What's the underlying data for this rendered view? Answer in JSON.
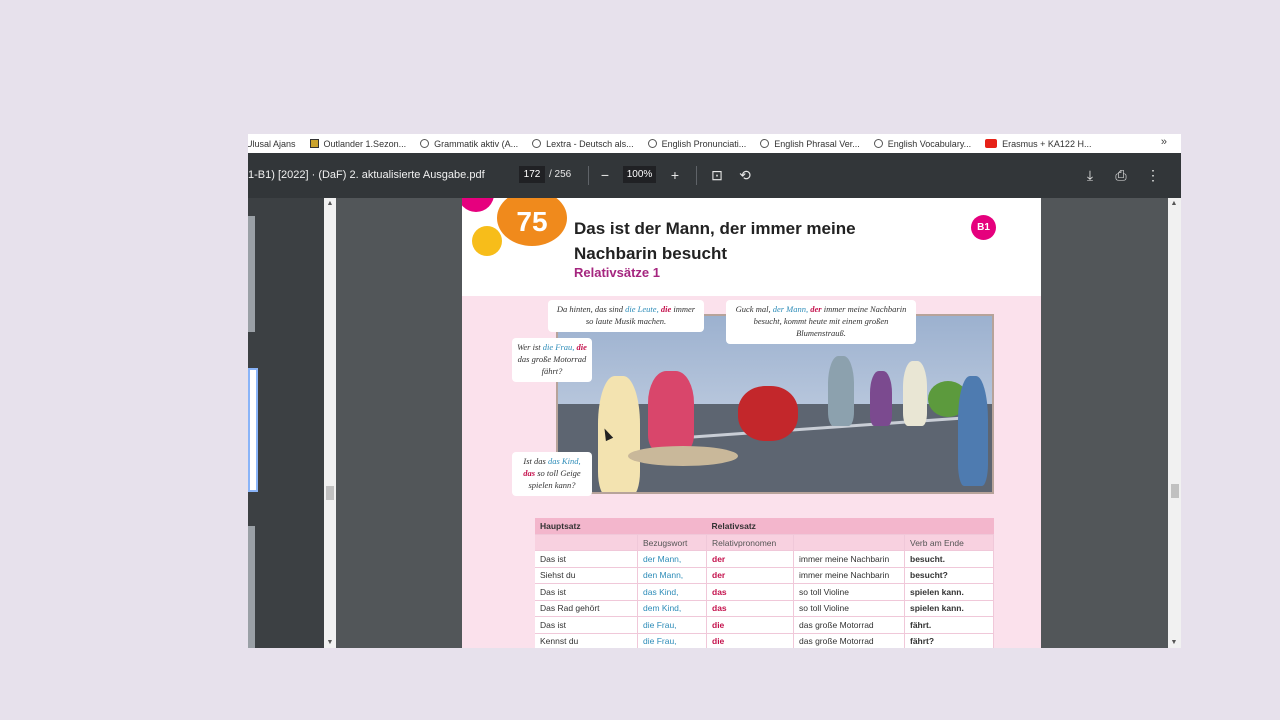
{
  "bookmarks": [
    {
      "label": "Ulusal Ajans",
      "icon": "none"
    },
    {
      "label": "Outlander 1.Sezon...",
      "icon": "folder-icon"
    },
    {
      "label": "Grammatik aktiv (A...",
      "icon": "globe-icon"
    },
    {
      "label": "Lextra - Deutsch als...",
      "icon": "globe-icon"
    },
    {
      "label": "English Pronunciati...",
      "icon": "globe-icon"
    },
    {
      "label": "English Phrasal Ver...",
      "icon": "globe-icon"
    },
    {
      "label": "English Vocabulary...",
      "icon": "globe-icon"
    },
    {
      "label": "Erasmus + KA122 H...",
      "icon": "youtube-icon"
    }
  ],
  "bookmarks_more": "»",
  "viewer": {
    "doc_title": "1-B1) [2022] · (DaF) 2. aktualisierte Ausgabe.pdf",
    "page_current": "172",
    "page_total": "/ 256",
    "zoom": "100%",
    "icons": {
      "zoom_out": "−",
      "zoom_in": "+",
      "fit": "⊡",
      "rotate": "⟲",
      "download": "⤓",
      "print": "⎙",
      "more": "⋮"
    }
  },
  "page": {
    "unit_number": "75",
    "title": "Das ist der Mann, der immer meine Nachbarin besucht",
    "subtitle": "Relativsätze 1",
    "level_badge": "B1",
    "bubbles": {
      "b1": {
        "t1": "Da hinten, das sind ",
        "b": "die Leute,",
        "r": "die",
        "t2": " immer so laute Musik machen."
      },
      "b2": {
        "t1": "Guck mal, ",
        "b": "der Mann,",
        "r": "der",
        "t2": " immer meine Nachbarin besucht, kommt heute mit einem großen Blumenstrauß."
      },
      "b3": {
        "t1": "Wer ist ",
        "b": "die Frau,",
        "r": "die",
        "t2": " das große Motorrad fährt?"
      },
      "b4": {
        "t1": "Ist das ",
        "b": "das Kind,",
        "r": "das",
        "t2": " so toll Geige spielen kann?"
      }
    },
    "table": {
      "header1": {
        "hauptsatz": "Hauptsatz",
        "relativsatz": "Relativsatz"
      },
      "header2": {
        "bezugswort": "Bezugswort",
        "relativpronomen": "Relativpronomen",
        "verb_am_ende": "Verb am Ende"
      },
      "rows": [
        {
          "hauptsatz": "Das ist",
          "bezugswort": "der Mann,",
          "pronomen": "der",
          "rest": "immer meine Nachbarin",
          "verb": "besucht."
        },
        {
          "hauptsatz": "Siehst du",
          "bezugswort": "den Mann,",
          "pronomen": "der",
          "rest": "immer meine Nachbarin",
          "verb": "besucht?"
        },
        {
          "hauptsatz": "Das ist",
          "bezugswort": "das Kind,",
          "pronomen": "das",
          "rest": "so toll Violine",
          "verb": "spielen kann."
        },
        {
          "hauptsatz": "Das Rad gehört",
          "bezugswort": "dem Kind,",
          "pronomen": "das",
          "rest": "so toll Violine",
          "verb": "spielen kann."
        },
        {
          "hauptsatz": "Das ist",
          "bezugswort": "die Frau,",
          "pronomen": "die",
          "rest": "das große Motorrad",
          "verb": "fährt."
        },
        {
          "hauptsatz": "Kennst du",
          "bezugswort": "die Frau,",
          "pronomen": "die",
          "rest": "das große Motorrad",
          "verb": "fährt?"
        }
      ]
    }
  },
  "colors": {
    "background": "#e7e1ec",
    "toolbar": "#323639",
    "accent_orange": "#f08a1c",
    "accent_magenta": "#e5007d",
    "table_header": "#f3b6cc"
  }
}
